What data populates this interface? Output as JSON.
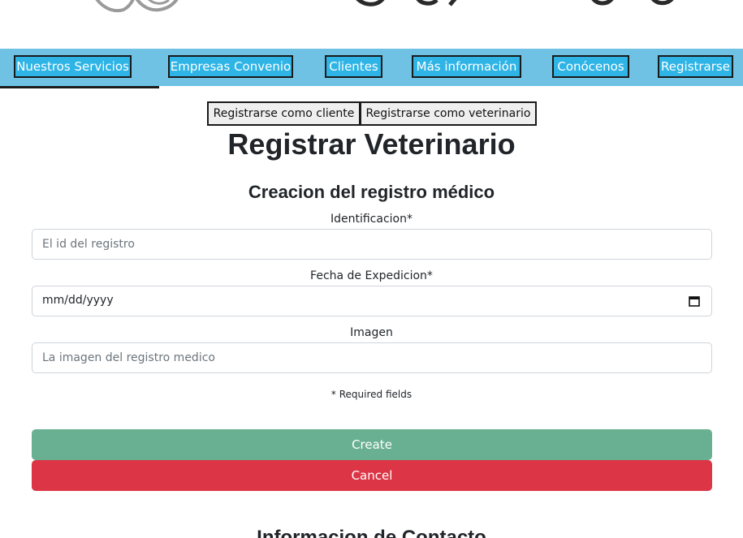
{
  "nav": {
    "items": [
      {
        "label": "Nuestros Servicios"
      },
      {
        "label": "Empresas Convenio"
      },
      {
        "label": "Clientes"
      },
      {
        "label": "Más información"
      },
      {
        "label": "Conócenos"
      },
      {
        "label": "Registrarse"
      }
    ]
  },
  "toggles": {
    "client_label": "Registrarse como cliente",
    "vet_label": "Registrarse como veterinario"
  },
  "page": {
    "title": "Registrar Veterinario",
    "section_title": "Creacion del registro médico"
  },
  "form": {
    "id_label": "Identificacion*",
    "id_placeholder": "El id del registro",
    "date_label": "Fecha de Expedicion*",
    "date_placeholder": "mm/dd/yyyy",
    "image_label": "Imagen",
    "image_placeholder": "La imagen del registro medico",
    "required_note": "* Required fields",
    "create_label": "Create",
    "cancel_label": "Cancel"
  },
  "footer": {
    "heading": "Informacion de Contacto"
  },
  "colors": {
    "navbar": "#6fc2e4",
    "nav_button": "#2fb4e6",
    "create": "#69b093",
    "cancel": "#dc3545"
  },
  "icons": {
    "date": "calendar-icon",
    "logo": "paw-logo-icon"
  }
}
